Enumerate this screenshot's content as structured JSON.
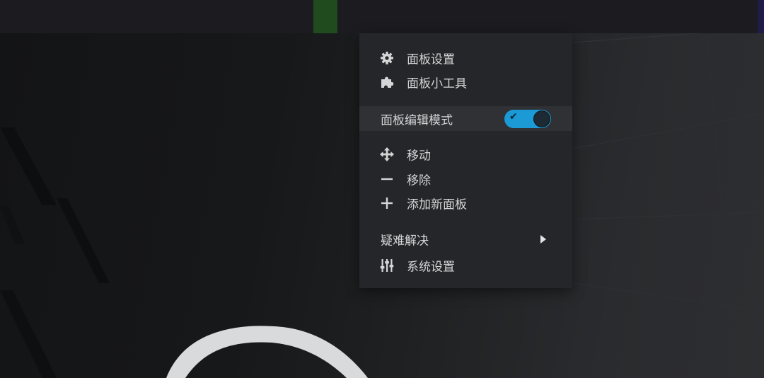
{
  "menu": {
    "panel_settings": {
      "label": "面板设置",
      "icon": "gear-icon"
    },
    "panel_widgets": {
      "label": "面板小工具",
      "icon": "puzzle-icon"
    },
    "edit_mode": {
      "label": "面板编辑模式",
      "enabled": true,
      "check_glyph": "✔"
    },
    "move": {
      "label": "移动",
      "icon": "move-arrows-icon"
    },
    "remove": {
      "label": "移除",
      "icon": "minus-icon"
    },
    "add_panel": {
      "label": "添加新面板",
      "icon": "plus-icon"
    },
    "troubleshoot": {
      "label": "疑难解决",
      "has_submenu": true
    },
    "system_settings": {
      "label": "系统设置",
      "icon": "sliders-icon"
    }
  },
  "colors": {
    "menu_background": "#252629",
    "toggle_accent": "#1b9ad6",
    "topbar_tab": "#1f4b1f"
  }
}
